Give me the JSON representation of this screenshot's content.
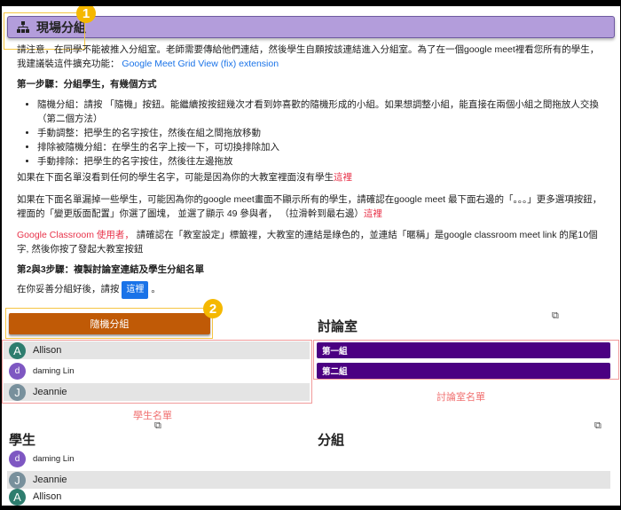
{
  "header": {
    "title": "現場分組",
    "icon": "sitemap-icon"
  },
  "annotations": {
    "one": "1",
    "two": "2",
    "student_list_label": "學生名單",
    "room_list_label": "討論室名單"
  },
  "intro": {
    "text": "請注意，在同學不能被推入分組室。老師需要傳給他們連結，然後學生自願按該連結進入分組室。為了在一個google meet裡看您所有的學生，我建議裝這件擴充功能：",
    "link": "Google Meet Grid View (fix) extension"
  },
  "step1": {
    "title": "第一步驟：分組學生，有幾個方式",
    "bullets": [
      "隨機分組：請按 「隨機」按鈕。能繼續按按鈕幾次才看到妳喜歡的隨機形成的小組。如果想調整小組，能直接在兩個小組之間拖放人交換 （第二個方法）",
      "手動調整：把學生的名字按住，然後在組之間拖放移動",
      "排除被隨機分組：在學生的名字上按一下，可切換排除加入",
      "手動排除：把學生的名字按住，然後往左邊拖放"
    ]
  },
  "note1": {
    "text": "如果在下面名單沒看到任何的學生名字，可能是因為你的大教室裡面沒有學生",
    "link": "這裡"
  },
  "note2": {
    "text": "如果在下面名單漏掉一些學生，可能因為你的google meet畫面不顯示所有的學生，請確認在google meet 最下面右邊的「。。。」更多選項按鈕，裡面的「變更版面配置」你選了圖塊， 並選了顯示 49 參與者， （拉滑幹到最右邊）",
    "link": "這裡"
  },
  "note3": {
    "prefix": "Google Classroom 使用者，",
    "text": " 請確認在「教室設定」標籤裡，大教室的連結是綠色的，並連結「暱稱」是google classroom meet link 的尾10個字, 然後你按了發起大教室按鈕"
  },
  "step23": {
    "title": "第2與3步驟：複製討論室連結及學生分組名單",
    "text": "在你妥善分組好後，請按",
    "button": "這裡",
    "suffix": "。"
  },
  "random_button": "隨機分組",
  "rooms_heading": "討論室",
  "students_pool": [
    {
      "initial": "A",
      "name": "Allison",
      "color": "#2e7d6e"
    },
    {
      "initial": "d",
      "name": "daming Lin",
      "color": "#7e57c2"
    },
    {
      "initial": "J",
      "name": "Jeannie",
      "color": "#78909c"
    }
  ],
  "rooms": [
    "第一組",
    "第二組"
  ],
  "students_heading": "學生",
  "groups_heading": "分組",
  "students_list": [
    {
      "initial": "d",
      "name": "daming Lin",
      "color": "#7e57c2"
    },
    {
      "initial": "J",
      "name": "Jeannie",
      "color": "#78909c"
    },
    {
      "initial": "A",
      "name": "Allison",
      "color": "#2e7d6e"
    }
  ]
}
